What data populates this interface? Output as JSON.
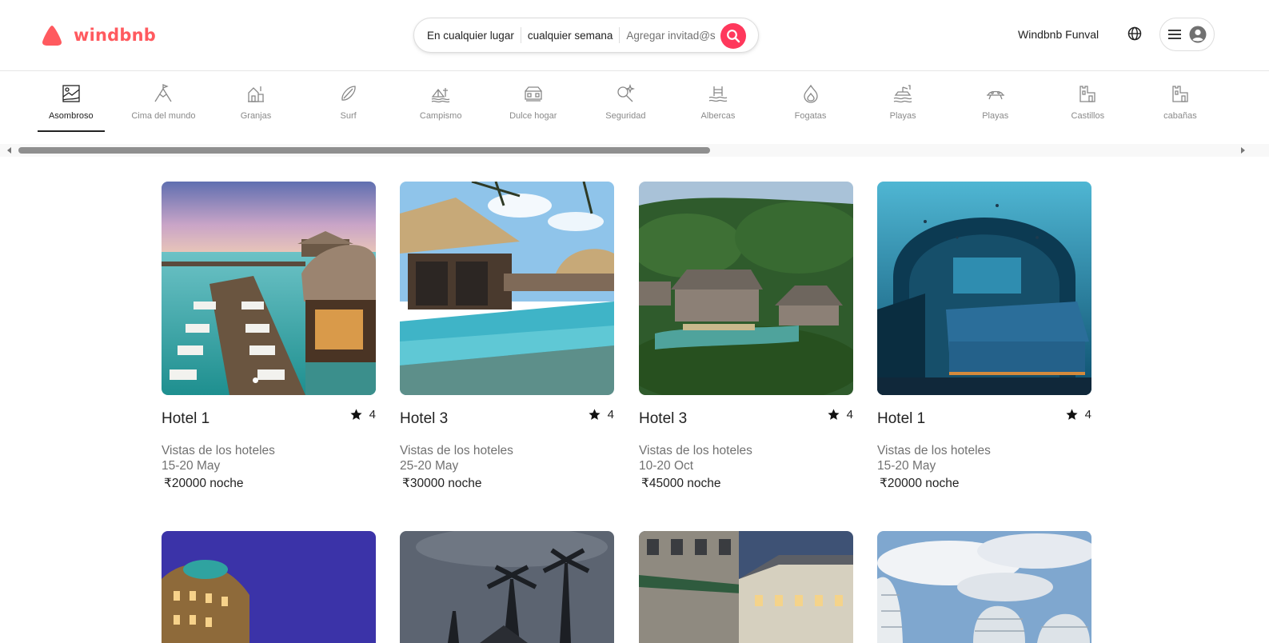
{
  "brand": {
    "name": "windbnb",
    "color": "#ff5a5f"
  },
  "search": {
    "location": "En cualquier lugar",
    "week": "cualquier semana",
    "guests_placeholder": "Agregar invitad@s",
    "button_color": "#ff385c"
  },
  "header": {
    "host_link": "Windbnb Funval",
    "globe_icon": "globe-icon",
    "menu_icon": "hamburger-icon",
    "avatar_icon": "user-avatar-icon"
  },
  "categories": [
    {
      "label": "Asombroso",
      "icon": "map-icon",
      "active": true
    },
    {
      "label": "Cima del mundo",
      "icon": "summit-icon"
    },
    {
      "label": "Granjas",
      "icon": "farm-icon"
    },
    {
      "label": "Surf",
      "icon": "surfboard-icon"
    },
    {
      "label": "Campismo",
      "icon": "camping-icon"
    },
    {
      "label": "Dulce hogar",
      "icon": "home-icon"
    },
    {
      "label": "Seguridad",
      "icon": "security-icon"
    },
    {
      "label": "Albercas",
      "icon": "pool-icon"
    },
    {
      "label": "Fogatas",
      "icon": "fire-icon"
    },
    {
      "label": "Playas",
      "icon": "beach-icon"
    },
    {
      "label": "Playas",
      "icon": "boat-icon"
    },
    {
      "label": "Castillos",
      "icon": "castle-icon"
    },
    {
      "label": "cabañas",
      "icon": "cabin-icon"
    }
  ],
  "listings": [
    {
      "title": "Hotel 1",
      "rating": "4",
      "desc": "Vistas de los hoteles",
      "dates": "15-20 May",
      "price": "₹20000",
      "unit": "noche"
    },
    {
      "title": "Hotel 3",
      "rating": "4",
      "desc": "Vistas de los hoteles",
      "dates": "25-20 May",
      "price": "₹30000",
      "unit": "noche"
    },
    {
      "title": "Hotel 3",
      "rating": "4",
      "desc": "Vistas de los hoteles",
      "dates": "10-20 Oct",
      "price": "₹45000",
      "unit": "noche"
    },
    {
      "title": "Hotel 1",
      "rating": "4",
      "desc": "Vistas de los hoteles",
      "dates": "15-20 May",
      "price": "₹20000",
      "unit": "noche"
    }
  ]
}
